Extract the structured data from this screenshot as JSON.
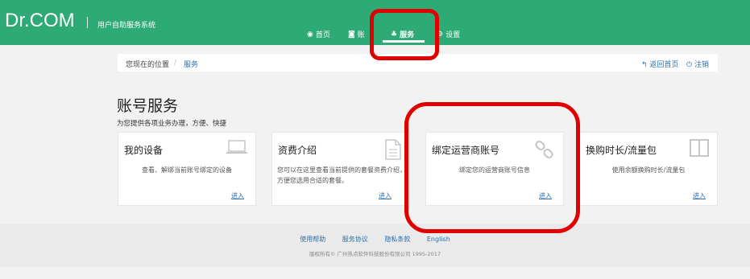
{
  "header": {
    "logo": "Dr.COM",
    "subtitle": "用户自助服务系统",
    "nav": [
      {
        "label": "首页",
        "icon": "dashboard-icon"
      },
      {
        "label": "账",
        "icon": "eye-icon"
      },
      {
        "label": "服务",
        "icon": "sitemap-icon",
        "active": true
      },
      {
        "label": "设置",
        "icon": "gear-icon"
      }
    ]
  },
  "breadcrumb": {
    "location_label": "您现在的位置",
    "current": "服务",
    "home_link": "返回首页",
    "logout_link": "注销"
  },
  "section": {
    "title": "账号服务",
    "subtitle": "为您提供各项业务办理，方便、快捷"
  },
  "cards": [
    {
      "title": "我的设备",
      "desc": "查看、解绑当前账号绑定的设备",
      "enter": "进入",
      "icon": "laptop-icon"
    },
    {
      "title": "资费介绍",
      "desc": "您可以在这里查看当前提供的套餐资费介绍，方便您选用合适的套餐。",
      "enter": "进入",
      "icon": "document-icon"
    },
    {
      "title": "绑定运营商账号",
      "desc": "绑定您的运营商账号信息",
      "enter": "进入",
      "icon": "link-icon"
    },
    {
      "title": "换购时长/流量包",
      "desc": "使用余额换购时长/流量包",
      "enter": "进入",
      "icon": "columns-icon"
    }
  ],
  "footer": {
    "links": [
      "使用帮助",
      "服务协议",
      "隐私条款",
      "English"
    ],
    "copyright": "版权所有© 广州热点软件科技股份有限公司 1995-2017"
  },
  "colors": {
    "header": "#2eaa77",
    "link": "#2c6fad",
    "highlight": "#e10000"
  }
}
